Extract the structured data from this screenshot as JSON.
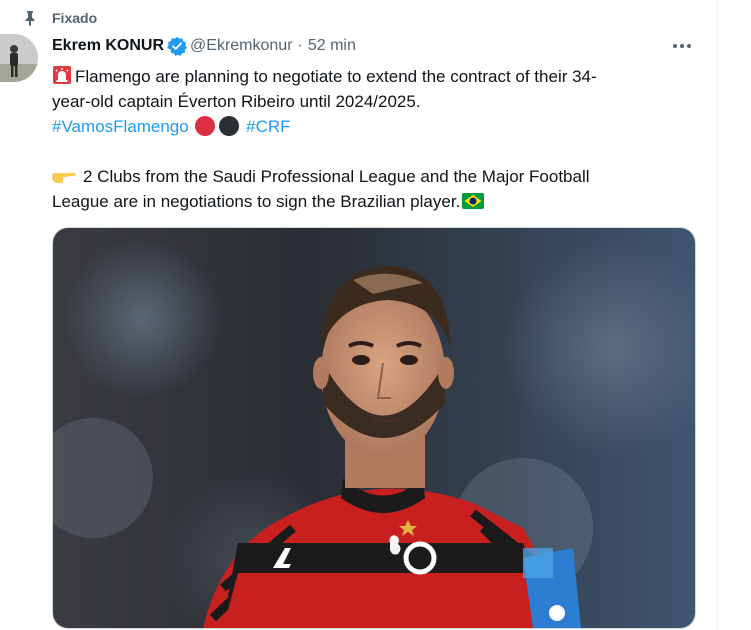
{
  "pinned": {
    "label": "Fixado",
    "icon": "pin-icon"
  },
  "author": {
    "name": "Ekrem KONUR",
    "handle": "@Ekremkonur",
    "separator": "·",
    "time": "52 min",
    "verified": true,
    "avatar_icon": "avatar"
  },
  "tweet": {
    "line1": "Flamengo are planning to negotiate to extend the contract of their 34-",
    "line2": "year-old captain Éverton Ribeiro until 2024/2025.",
    "hashtag1": "#VamosFlamengo",
    "hashtag2": "#CRF",
    "line4": "2 Clubs from the Saudi Professional League and the Major Football",
    "line5": "League are in negotiations to sign the Brazilian player.",
    "emojis": [
      "siren-icon",
      "red-circle-icon",
      "black-circle-icon",
      "point-right-icon",
      "brazil-flag-icon"
    ]
  },
  "colors": {
    "link": "#1d9bf0",
    "verified": "#1d9bf0",
    "flamengo_red": "#d91b27",
    "secondary_text": "#536471"
  },
  "media": {
    "type": "photo",
    "subject": "soccer-player-photo"
  }
}
